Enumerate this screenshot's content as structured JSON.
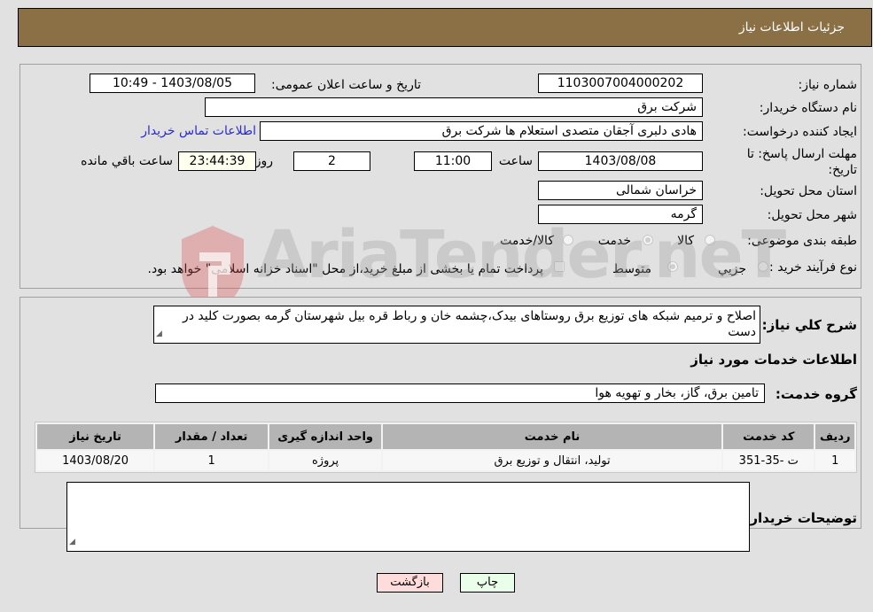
{
  "header": {
    "title": "جزئیات اطلاعات نیاز"
  },
  "details": {
    "need_number_label": "شماره نیاز:",
    "need_number": "1103007004000202",
    "announce_label": "تاریخ و ساعت اعلان عمومی:",
    "announce_value": "1403/08/05 - 10:49",
    "buyer_org_label": "نام دستگاه خریدار:",
    "buyer_org": "شرکت برق",
    "creator_label": "ایجاد کننده درخواست:",
    "creator": "هادی دلبری آجقان متصدی استعلام ها  شرکت برق",
    "contact_link": "اطلاعات تماس خریدار",
    "deadline_label": "مهلت ارسال پاسخ: تا تاریخ:",
    "deadline_date": "1403/08/08",
    "time_label": "ساعت",
    "deadline_time": "11:00",
    "days": "2",
    "days_label": "روز و",
    "remaining": "23:44:39",
    "remaining_label": "ساعت باقي مانده",
    "province_label": "استان محل تحویل:",
    "province": "خراسان شمالی",
    "city_label": "شهر محل تحویل:",
    "city": "گرمه",
    "category_label": "طبقه بندی موضوعی:",
    "category_options": [
      "کالا",
      "خدمت",
      "کالا/خدمت"
    ],
    "category_selected": "خدمت",
    "process_label": "نوع فرآیند خرید :",
    "process_options": [
      "جزيي",
      "متوسط"
    ],
    "process_selected": "متوسط",
    "payment_note": "پرداخت تمام یا بخشی از مبلغ خرید،از محل \"اسناد خزانه اسلامی\" خواهد بود."
  },
  "description": {
    "label": "شرح کلي نياز:",
    "text": "اصلاح و ترمیم شبکه های توزیع برق روستاهای بیدک،چشمه خان و رباط قره بیل شهرستان گرمه بصورت کلید در دست"
  },
  "services": {
    "section_title": "اطلاعات خدمات مورد نیاز",
    "group_label": "گروه خدمت:",
    "group_value": "تامین برق، گاز، بخار و تهویه هوا",
    "columns": [
      "ردیف",
      "کد خدمت",
      "نام خدمت",
      "واحد اندازه گیری",
      "تعداد / مقدار",
      "تاریخ نیاز"
    ],
    "rows": [
      [
        "1",
        "ت -35-351",
        "تولید، انتقال و توزیع برق",
        "پروژه",
        "1",
        "1403/08/20"
      ]
    ]
  },
  "buyer_notes": {
    "label": "توضیحات خریدار:",
    "text": ""
  },
  "buttons": {
    "print": "چاپ",
    "back": "بازگشت"
  },
  "watermark": {
    "text": "AriaTender.neT"
  },
  "colors": {
    "header_bg": "#8b6f45",
    "print_bg": "#eaffea",
    "back_bg": "#ffdcdc",
    "link": "#2a2ad6"
  }
}
